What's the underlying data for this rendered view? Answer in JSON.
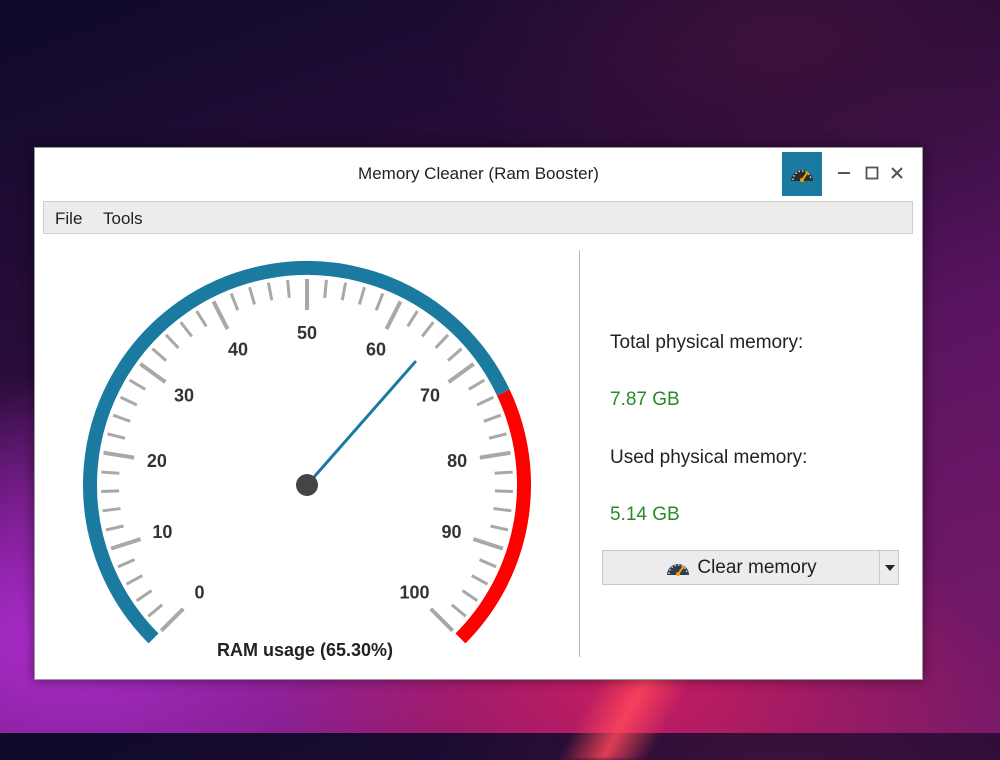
{
  "window": {
    "title": "Memory Cleaner (Ram Booster)",
    "app_icon": "speedometer-icon",
    "controls": [
      "minimize-icon",
      "maximize-icon",
      "close-icon"
    ]
  },
  "menu": {
    "file": "File",
    "tools": "Tools"
  },
  "gauge": {
    "ticks": [
      "0",
      "10",
      "20",
      "30",
      "40",
      "50",
      "60",
      "70",
      "80",
      "90",
      "100"
    ],
    "value_percent": 65.3,
    "danger_from": 74,
    "caption": "RAM usage (65.30%)",
    "colors": {
      "arc": "#1a7aa0",
      "danger": "#ff0000",
      "needle": "#1a7aa0",
      "ticks": "#a8a8a8",
      "hub": "#444444"
    }
  },
  "info": {
    "total_label": "Total physical memory:",
    "total_value": "7.87 GB",
    "used_label": "Used physical memory:",
    "used_value": "5.14 GB",
    "value_color": "#2a8a2a"
  },
  "actions": {
    "clear_label": "Clear memory",
    "clear_icon": "speedometer-icon",
    "dropdown_icon": "caret-down-icon"
  }
}
